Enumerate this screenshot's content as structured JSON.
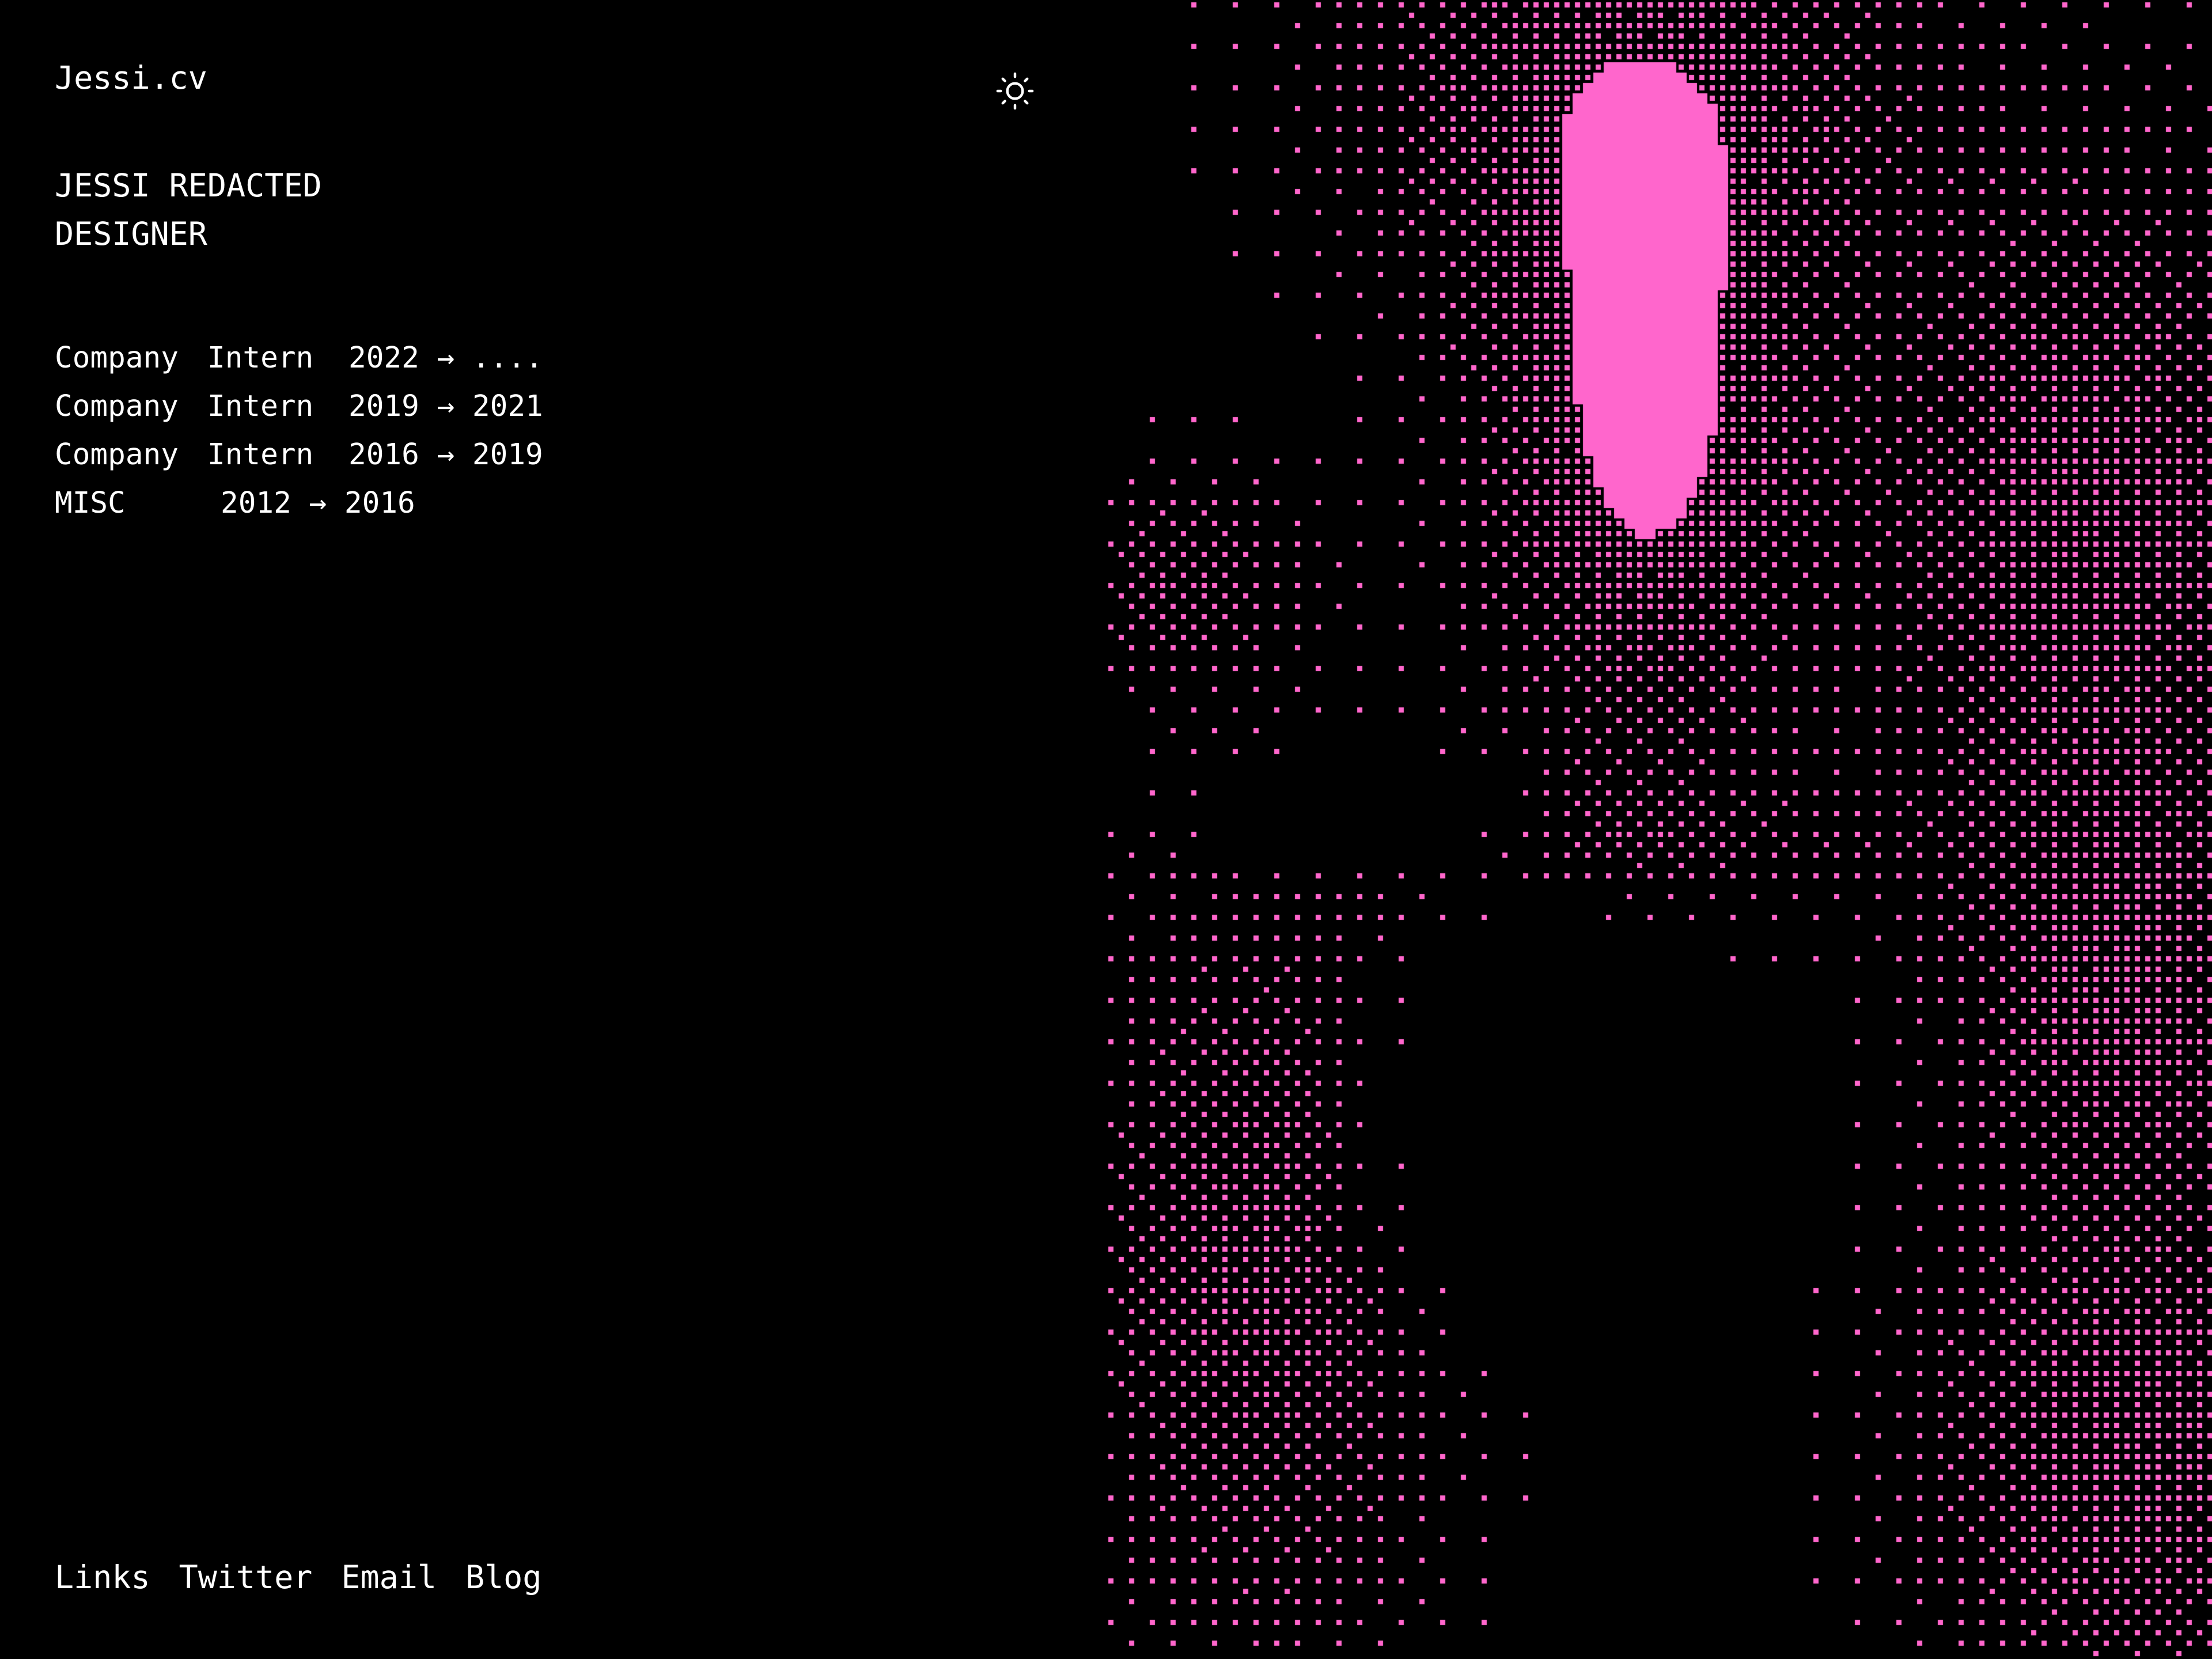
{
  "header": {
    "site_title": "Jessi.cv",
    "theme_toggle_icon": "sun-icon"
  },
  "profile": {
    "name": "JESSI REDACTED",
    "role": "DESIGNER"
  },
  "experience": [
    {
      "company": "Company",
      "role": "Intern",
      "period": "2022 → ...."
    },
    {
      "company": "Company",
      "role": "Intern",
      "period": "2019 → 2021"
    },
    {
      "company": "Company",
      "role": "Intern",
      "period": "2016 → 2019"
    },
    {
      "company": "MISC",
      "role": "",
      "period": "2012 → 2016"
    }
  ],
  "footer": {
    "links": [
      "Links",
      "Twitter",
      "Email",
      "Blog"
    ]
  },
  "colors": {
    "background": "#000000",
    "text": "#ffffff",
    "accent": "#ff66cc"
  }
}
